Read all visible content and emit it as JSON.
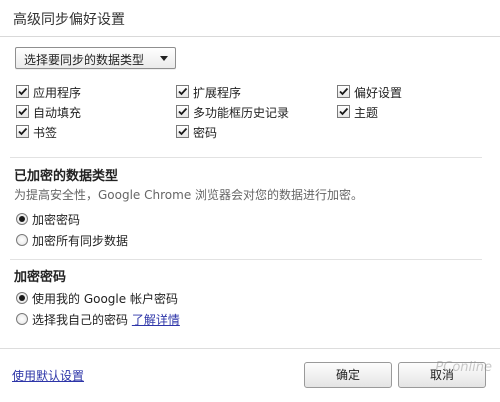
{
  "dialog": {
    "title": "高级同步偏好设置"
  },
  "sync_type_select": {
    "value": "选择要同步的数据类型"
  },
  "checkboxes": [
    {
      "label": "应用程序",
      "checked": true
    },
    {
      "label": "扩展程序",
      "checked": true
    },
    {
      "label": "偏好设置",
      "checked": true
    },
    {
      "label": "自动填充",
      "checked": true
    },
    {
      "label": "多功能框历史记录",
      "checked": true
    },
    {
      "label": "主题",
      "checked": true
    },
    {
      "label": "书签",
      "checked": true
    },
    {
      "label": "密码",
      "checked": true
    }
  ],
  "encrypted_types": {
    "heading": "已加密的数据类型",
    "description": "为提高安全性，Google Chrome 浏览器会对您的数据进行加密。",
    "options": [
      {
        "label": "加密密码",
        "selected": true
      },
      {
        "label": "加密所有同步数据",
        "selected": false
      }
    ]
  },
  "passphrase": {
    "heading": "加密密码",
    "options": [
      {
        "label": "使用我的 Google 帐户密码",
        "selected": true
      },
      {
        "label": "选择我自己的密码",
        "selected": false
      }
    ],
    "learn_more_link": "了解详情"
  },
  "footer": {
    "use_default_link": "使用默认设置",
    "ok_button": "确定",
    "cancel_button": "取消"
  },
  "watermark": {
    "text": "PConline"
  },
  "icons": {
    "checkbox_check": "checkmark-icon",
    "select_arrow": "triangle-down-icon"
  }
}
